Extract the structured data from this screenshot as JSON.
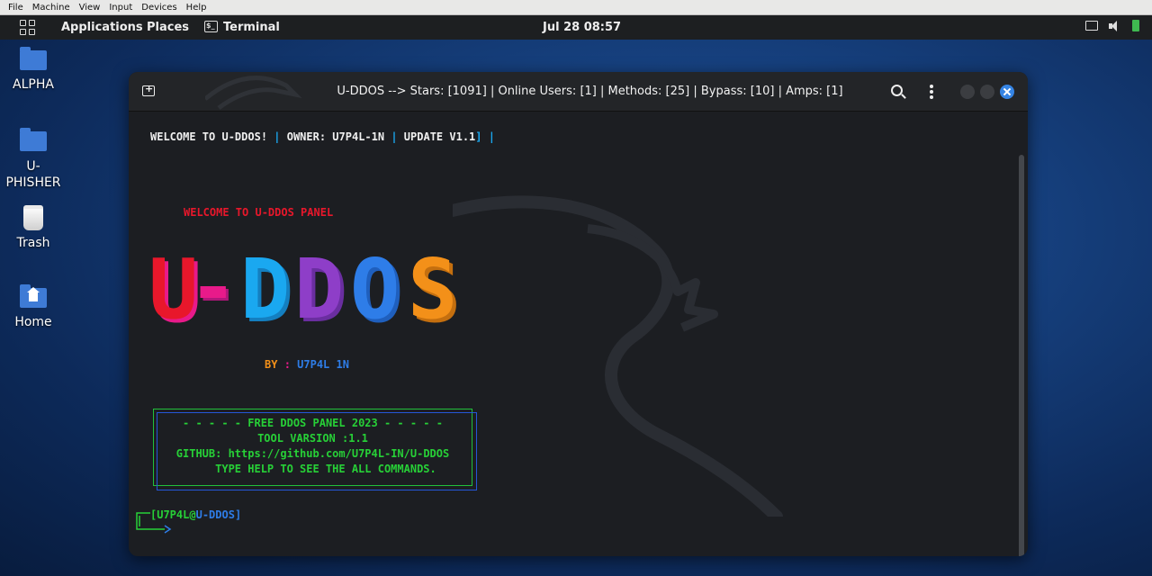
{
  "vm_menu": [
    "File",
    "Machine",
    "View",
    "Input",
    "Devices",
    "Help"
  ],
  "topbar": {
    "applications": "Applications",
    "places": "Places",
    "terminal": "Terminal",
    "clock": "Jul 28  08:57",
    "tray_icons": [
      "display-icon",
      "volume-icon",
      "battery-icon"
    ]
  },
  "desktop_icons": [
    {
      "label": "ALPHA",
      "icon": "folder-icon"
    },
    {
      "label": "U-\nPHISHER",
      "icon": "folder-icon"
    },
    {
      "label": "Trash",
      "icon": "trash-icon"
    },
    {
      "label": "Home",
      "icon": "home-folder-icon"
    }
  ],
  "terminal": {
    "title": "U-DDOS --> Stars: [1091] | Online Users: [1] | Methods: [25] | Bypass: [10] | Amps: [1]",
    "header_line": {
      "welcome": "WELCOME TO U-DDOS!",
      "sep1": " | ",
      "owner": "OWNER: U7P4L-1N",
      "sep2": " | ",
      "update": "UPDATE V1.1",
      "end": "] |"
    },
    "panel_welcome": "WELCOME TO U-DDOS PANEL",
    "logo_letters": [
      "U",
      "-",
      "D",
      "D",
      "O",
      "S"
    ],
    "by_label": "BY",
    "by_sep": ":",
    "by_author": "U7P4L 1N",
    "box_lines": [
      "- - - - - FREE DDOS PANEL 2023 - - - - -",
      "TOOL VARSION :1.1",
      "GITHUB: https://github.com/U7P4L-IN/U-DDOS",
      "    TYPE HELP TO SEE THE ALL COMMANDS."
    ],
    "prompt_user": "U7P4L",
    "prompt_at": "@",
    "prompt_host": "U-DDOS",
    "prompt_bracket": "]"
  },
  "colors": {
    "red": "#e8172b",
    "pink": "#e81a8a",
    "cyan": "#1aa8f0",
    "purple": "#8e3ec8",
    "blue": "#2e7de8",
    "orange": "#f39019",
    "green": "#27d037",
    "white": "#f0f0f0"
  }
}
